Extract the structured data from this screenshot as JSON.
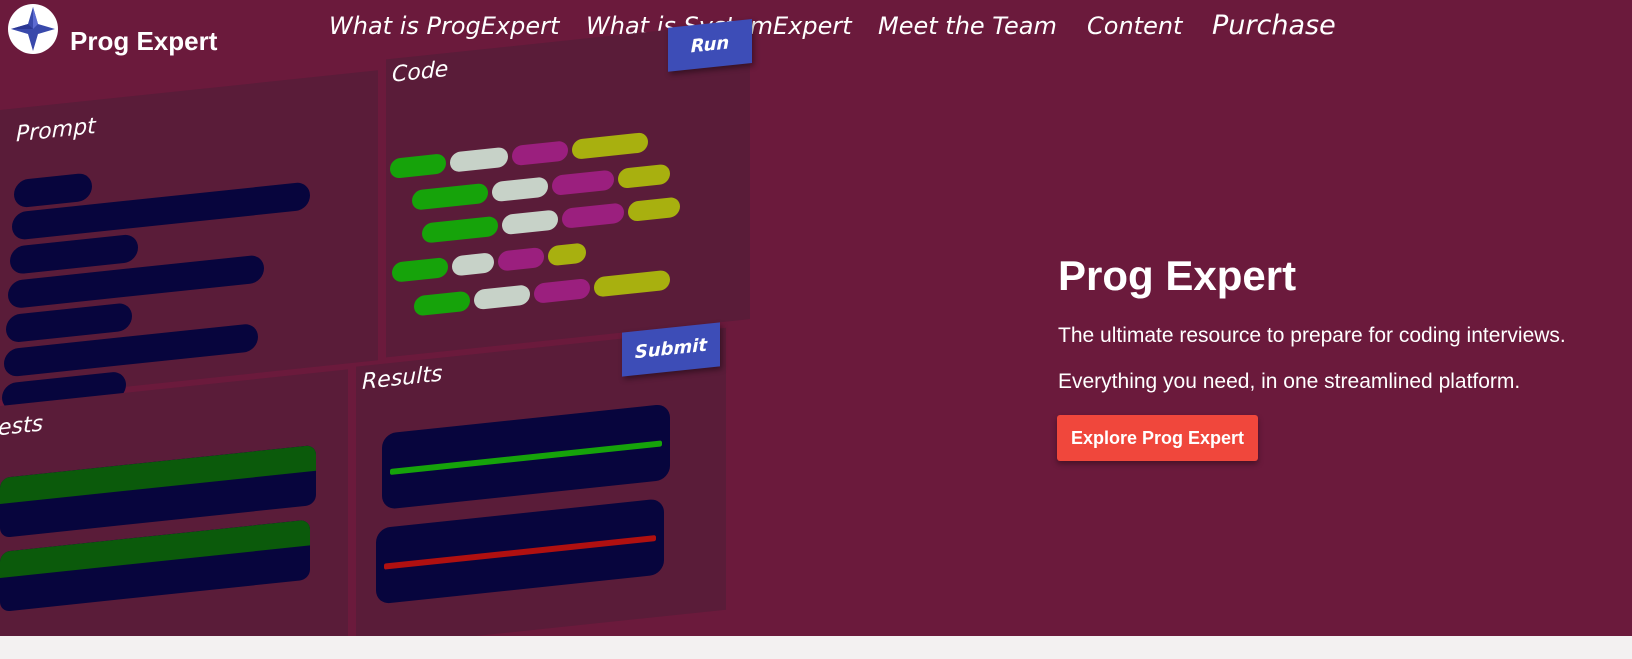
{
  "brand": {
    "name": "Prog Expert",
    "logo_icon": "compass-star-icon"
  },
  "nav": {
    "items": [
      {
        "label": "What is ProgExpert"
      },
      {
        "label": "What is SystemExpert"
      },
      {
        "label": "Meet the Team"
      },
      {
        "label": "Content"
      },
      {
        "label": "Purchase"
      }
    ]
  },
  "mockup": {
    "prompt_title": "Prompt",
    "code_title": "Code",
    "tests_title": "ests",
    "results_title": "Results",
    "run_label": "Run",
    "submit_label": "Submit"
  },
  "hero": {
    "title": "Prog Expert",
    "line1": "The ultimate resource to prepare for coding interviews.",
    "line2": "Everything you need, in one streamlined platform.",
    "cta_label": "Explore Prog Expert"
  },
  "colors": {
    "background": "#6b1a3c",
    "panel": "#5a1c39",
    "dark_bar": "#07053d",
    "accent_button": "#f0473c",
    "mock_button": "#3d4db7",
    "code_green": "#16a30a",
    "code_gray": "#c7d2c8",
    "code_magenta": "#9b1f7e",
    "code_olive": "#a8b00f"
  }
}
